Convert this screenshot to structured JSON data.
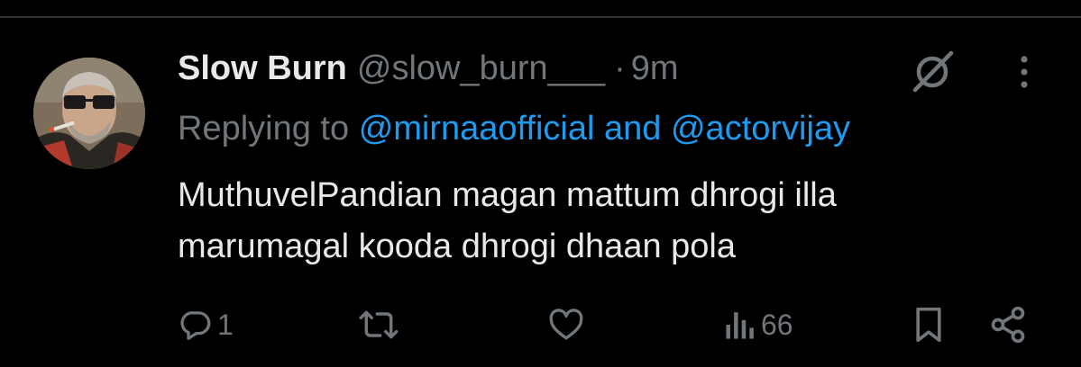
{
  "tweet": {
    "author_name": "Slow Burn",
    "author_handle": "@slow_burn___",
    "separator": "·",
    "time": "9m",
    "replying_prefix": "Replying to",
    "reply_mention_1": "@mirnaaofficial",
    "reply_conjunction": "and",
    "reply_mention_2": "@actorvijay",
    "text_line_1": "MuthuvelPandian magan mattum dhrogi illa",
    "text_line_2": "marumagal kooda dhrogi dhaan pola"
  },
  "actions": {
    "reply_count": "1",
    "retweet_count": "",
    "like_count": "",
    "views_count": "66"
  },
  "icons": {
    "header": [
      "grok-icon",
      "more-options-icon"
    ],
    "actions": [
      "reply-icon",
      "retweet-icon",
      "like-icon",
      "views-icon",
      "bookmark-icon",
      "share-icon"
    ]
  },
  "colors": {
    "background": "#000000",
    "primary_text": "#e7e9ea",
    "secondary_text": "#71767b",
    "link": "#1d9bf0",
    "divider": "#2f3336"
  }
}
